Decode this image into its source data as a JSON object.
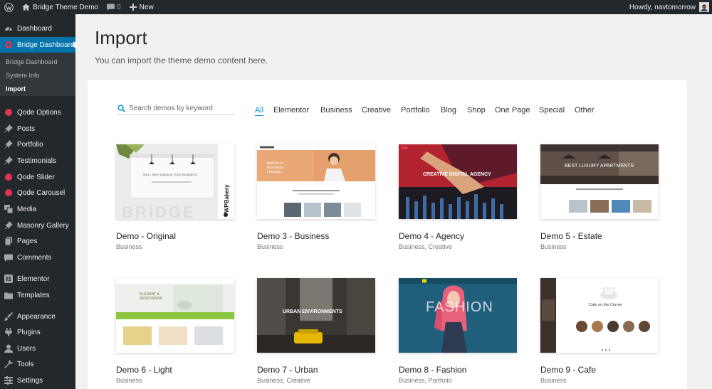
{
  "adminbar": {
    "site_name": "Bridge Theme Demo",
    "comments_count": "0",
    "new_label": "New",
    "howdy": "Howdy, navtomorrow"
  },
  "sidebar": {
    "items": [
      {
        "label": "Dashboard",
        "icon": "dashboard-icon"
      },
      {
        "label": "Bridge Dashboard",
        "icon": "qode-icon"
      },
      {
        "label": "Qode Options",
        "icon": "qode-icon"
      },
      {
        "label": "Posts",
        "icon": "pin-icon"
      },
      {
        "label": "Portfolio",
        "icon": "pin-icon"
      },
      {
        "label": "Testimonials",
        "icon": "pin-icon"
      },
      {
        "label": "Qode Slider",
        "icon": "qode-icon"
      },
      {
        "label": "Qode Carousel",
        "icon": "qode-icon"
      },
      {
        "label": "Media",
        "icon": "media-icon"
      },
      {
        "label": "Masonry Gallery",
        "icon": "pin-icon"
      },
      {
        "label": "Pages",
        "icon": "pages-icon"
      },
      {
        "label": "Comments",
        "icon": "comment-icon"
      },
      {
        "label": "Elementor",
        "icon": "elementor-icon"
      },
      {
        "label": "Templates",
        "icon": "folder-icon"
      },
      {
        "label": "Appearance",
        "icon": "brush-icon"
      },
      {
        "label": "Plugins",
        "icon": "plug-icon"
      },
      {
        "label": "Users",
        "icon": "user-icon"
      },
      {
        "label": "Tools",
        "icon": "wrench-icon"
      },
      {
        "label": "Settings",
        "icon": "settings-icon"
      }
    ],
    "submenu": [
      "Bridge Dashboard",
      "System Info",
      "Import"
    ]
  },
  "page": {
    "title": "Import",
    "description": "You can import the theme demo content here."
  },
  "search": {
    "placeholder": "Search demos by keyword"
  },
  "filters": [
    "All",
    "Elementor",
    "Business",
    "Creative",
    "Portfolio",
    "Blog",
    "Shop",
    "One Page",
    "Special",
    "Other"
  ],
  "demos": [
    {
      "title": "Demo - Original",
      "categories": "Business",
      "thumb_text": "WE'LL HELP MANAGE YOUR BUSINESS",
      "badge": "WPBakery",
      "watermark": "BRIDGE"
    },
    {
      "title": "Demo 3 - Business",
      "categories": "Business",
      "thumb_text": "BRIDGE IS BUSINESS FRIENDLY"
    },
    {
      "title": "Demo 4 - Agency",
      "categories": "Business,  Creative",
      "thumb_text": "CREATIVE DIGITAL AGENCY"
    },
    {
      "title": "Demo 5 - Estate",
      "categories": "Business",
      "thumb_text": "BEST LUXURY APARTMENTS"
    },
    {
      "title": "Demo 6 - Light",
      "categories": "Business",
      "thumb_text": "ELEGANT & RESPONSIVE"
    },
    {
      "title": "Demo 7 - Urban",
      "categories": "Business,  Creative",
      "thumb_text": "URBAN ENVIRONMENTS"
    },
    {
      "title": "Demo 8 - Fashion",
      "categories": "Business,  Portfolio",
      "thumb_text": "FASHION"
    },
    {
      "title": "Demo 9 - Cafe",
      "categories": "Business",
      "thumb_text": "Cafe on the Corner"
    }
  ],
  "colors": {
    "admin_bg": "#23282d",
    "active_menu": "#0073aa",
    "qode_red": "#e1354c",
    "filter_active": "#0a8fd0"
  }
}
